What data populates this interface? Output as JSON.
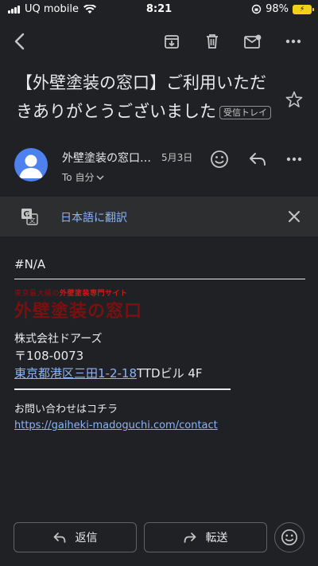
{
  "status_bar": {
    "carrier": "UQ mobile",
    "time": "8:21",
    "battery": "98%"
  },
  "email": {
    "subject": "【外壁塗装の窓口】ご利用いただきありがとうございました",
    "label": "受信トレイ",
    "sender": "外壁塗装の窓口…",
    "date": "5月3日",
    "recipient": "To 自分"
  },
  "translate": {
    "label": "日本語に翻訳"
  },
  "body": {
    "first_line": "#N/A",
    "logo_tagline_prefix": "東京最大級の",
    "logo_tagline_highlight": "外壁塗装専門サイト",
    "logo_name": "外壁塗装の窓口",
    "company": "株式会社ドアーズ",
    "postal": "〒108-0073",
    "address_link": "東京都港区三田1-2-18",
    "address_rest": "TTDビル 4F",
    "contact_label": "お問い合わせはコチラ",
    "contact_url": "https://gaiheki-madoguchi.com/contact"
  },
  "actions": {
    "reply": "返信",
    "forward": "転送"
  }
}
